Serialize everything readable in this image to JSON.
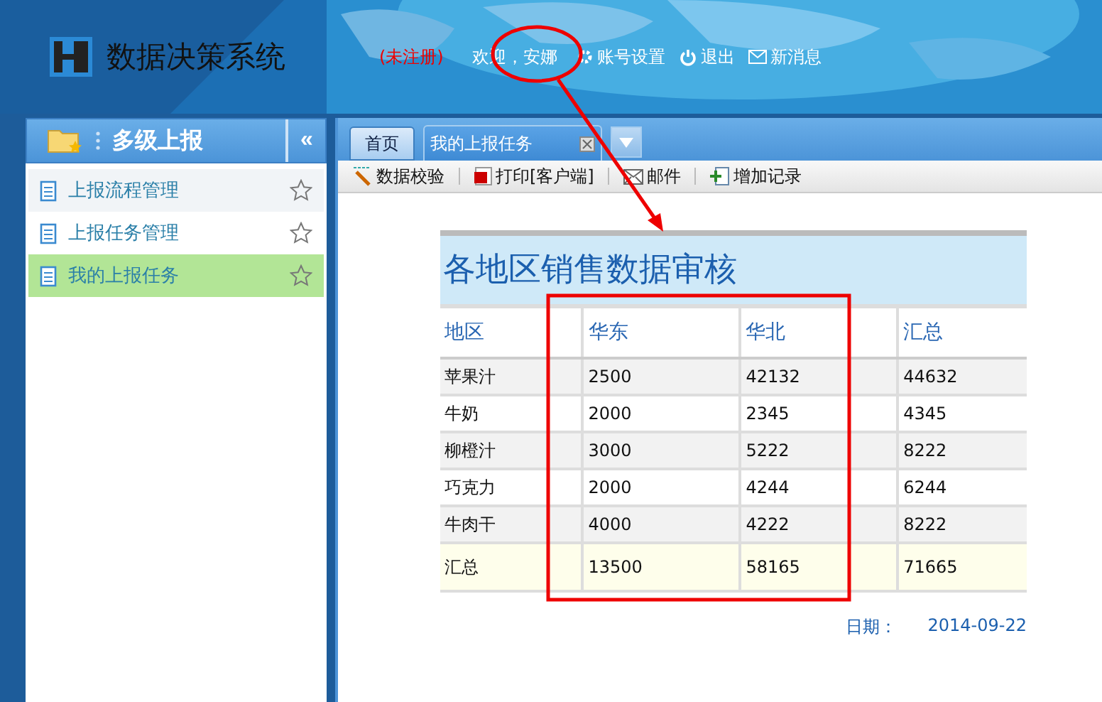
{
  "header": {
    "title": "数据决策系统",
    "status": "(未注册)",
    "welcome": "欢迎，安娜",
    "links": [
      {
        "kind": "settings",
        "label": "账号设置"
      },
      {
        "kind": "logout",
        "label": "退出"
      },
      {
        "kind": "mail",
        "label": "新消息"
      }
    ]
  },
  "sidebar": {
    "title": "多级上报",
    "collapse": "«",
    "items": [
      {
        "label": "上报流程管理",
        "selected": false,
        "hovered": true
      },
      {
        "label": "上报任务管理",
        "selected": false,
        "hovered": false
      },
      {
        "label": "我的上报任务",
        "selected": true,
        "hovered": false
      }
    ]
  },
  "tabs": [
    {
      "label": "首页",
      "kind": "home"
    },
    {
      "label": "我的上报任务",
      "kind": "closable"
    }
  ],
  "toolbar": [
    {
      "kind": "check",
      "label": "数据校验"
    },
    {
      "kind": "print",
      "label": "打印[客户端]"
    },
    {
      "kind": "mail",
      "label": "邮件"
    },
    {
      "kind": "add",
      "label": "增加记录"
    }
  ],
  "report": {
    "title": "各地区销售数据审核",
    "columns": [
      "地区",
      "华东",
      "华北",
      "汇总"
    ],
    "rows": [
      {
        "kind": "data",
        "cells": [
          "苹果汁",
          "2500",
          "42132",
          "44632"
        ]
      },
      {
        "kind": "data",
        "cells": [
          "牛奶",
          "2000",
          "2345",
          "4345"
        ]
      },
      {
        "kind": "data",
        "cells": [
          "柳橙汁",
          "3000",
          "5222",
          "8222"
        ]
      },
      {
        "kind": "data",
        "cells": [
          "巧克力",
          "2000",
          "4244",
          "6244"
        ]
      },
      {
        "kind": "data",
        "cells": [
          "牛肉干",
          "4000",
          "4222",
          "8222"
        ]
      },
      {
        "kind": "total",
        "cells": [
          "汇总",
          "13500",
          "58165",
          "71665"
        ]
      }
    ],
    "date_label": "日期：",
    "date": "2014-09-22"
  }
}
